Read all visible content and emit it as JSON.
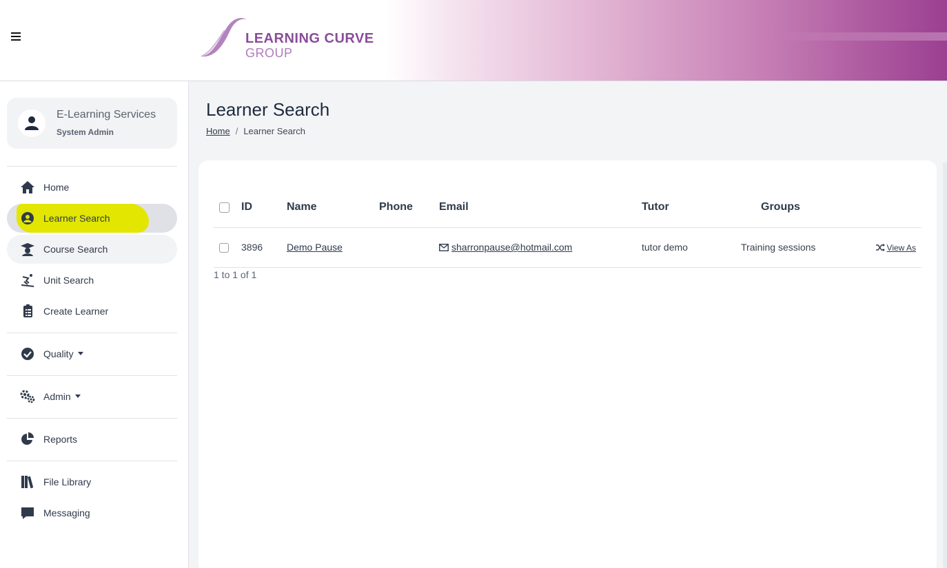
{
  "header": {
    "logo_line1": "LEARNING CURVE",
    "logo_line2": "GROUP",
    "brand_color": "#8a4c9a"
  },
  "sidebar": {
    "user": {
      "name": "E-Learning Services",
      "role": "System Admin"
    },
    "items": [
      {
        "label": "Home",
        "icon": "home-icon"
      },
      {
        "label": "Learner Search",
        "icon": "user-circle-icon",
        "active": true
      },
      {
        "label": "Course Search",
        "icon": "graduation-cap-icon"
      },
      {
        "label": "Unit Search",
        "icon": "skiing-icon"
      },
      {
        "label": "Create Learner",
        "icon": "clipboard-list-icon"
      },
      {
        "label": "Quality",
        "icon": "check-circle-icon",
        "dropdown": true
      },
      {
        "label": "Admin",
        "icon": "cogs-icon",
        "dropdown": true
      },
      {
        "label": "Reports",
        "icon": "pie-chart-icon"
      },
      {
        "label": "File Library",
        "icon": "books-icon"
      },
      {
        "label": "Messaging",
        "icon": "comment-icon"
      }
    ]
  },
  "page": {
    "title": "Learner Search",
    "breadcrumb": {
      "home": "Home",
      "current": "Learner Search",
      "separator": "/"
    }
  },
  "table": {
    "columns": [
      "ID",
      "Name",
      "Phone",
      "Email",
      "Tutor",
      "Groups"
    ],
    "rows": [
      {
        "id": "3896",
        "name": "Demo Pause",
        "phone": "",
        "email": "sharronpause@hotmail.com",
        "tutor": "tutor demo",
        "groups": "Training sessions",
        "action": "View As"
      }
    ],
    "pagination": "1 to 1 of 1"
  },
  "colors": {
    "highlight": "#e2e600",
    "text_dark": "#1e2b3c",
    "main_bg": "#f3f4f6"
  }
}
